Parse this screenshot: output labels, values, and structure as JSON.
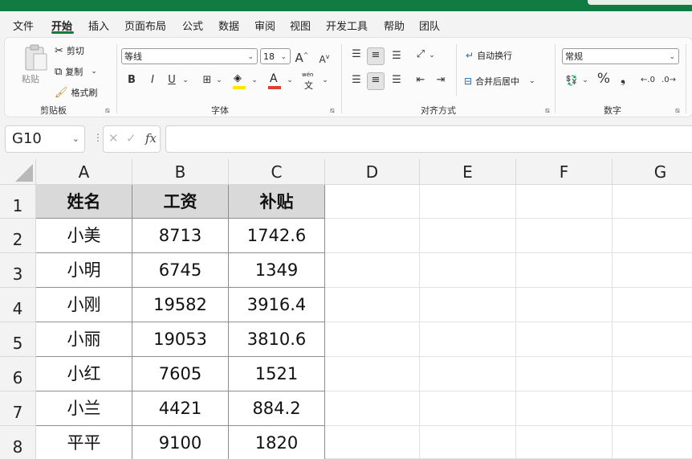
{
  "menu": {
    "tabs": [
      {
        "label": "文件"
      },
      {
        "label": "开始"
      },
      {
        "label": "插入"
      },
      {
        "label": "页面布局"
      },
      {
        "label": "公式"
      },
      {
        "label": "数据"
      },
      {
        "label": "审阅"
      },
      {
        "label": "视图"
      },
      {
        "label": "开发工具"
      },
      {
        "label": "帮助"
      },
      {
        "label": "团队"
      }
    ],
    "active_tab": "开始"
  },
  "ribbon": {
    "clipboard": {
      "paste_label": "粘贴",
      "cut_label": "剪切",
      "copy_label": "复制",
      "format_painter_label": "格式刷",
      "group_label": "剪贴板"
    },
    "font": {
      "font_name": "等线",
      "font_size": "18",
      "grow_label": "A",
      "shrink_label": "A",
      "bold_label": "B",
      "italic_label": "I",
      "underline_label": "U",
      "wen_label": "wén",
      "wen_char": "文",
      "group_label": "字体"
    },
    "alignment": {
      "wrap_text_label": "自动换行",
      "merge_center_label": "合并后居中",
      "group_label": "对齐方式"
    },
    "number": {
      "format_value": "常规",
      "percent_label": "%",
      "comma_label": "❟",
      "group_label": "数字"
    }
  },
  "formula_bar": {
    "name_box": "G10",
    "fx_label": "fx",
    "formula": ""
  },
  "sheet": {
    "columns": [
      "A",
      "B",
      "C",
      "D",
      "E",
      "F",
      "G"
    ],
    "rows": [
      "1",
      "2",
      "3",
      "4",
      "5",
      "6",
      "7",
      "8"
    ],
    "header": [
      "姓名",
      "工资",
      "补贴"
    ],
    "data": [
      [
        "小美",
        "8713",
        "1742.6"
      ],
      [
        "小明",
        "6745",
        "1349"
      ],
      [
        "小刚",
        "19582",
        "3916.4"
      ],
      [
        "小丽",
        "19053",
        "3810.6"
      ],
      [
        "小红",
        "7605",
        "1521"
      ],
      [
        "小兰",
        "4421",
        "884.2"
      ],
      [
        "平平",
        "9100",
        "1820"
      ]
    ]
  },
  "colors": {
    "accent": "#107c41",
    "header_fill": "#d9d9d9",
    "font_color_bar": "#e03c31",
    "highlight_bar": "#ffe600"
  }
}
